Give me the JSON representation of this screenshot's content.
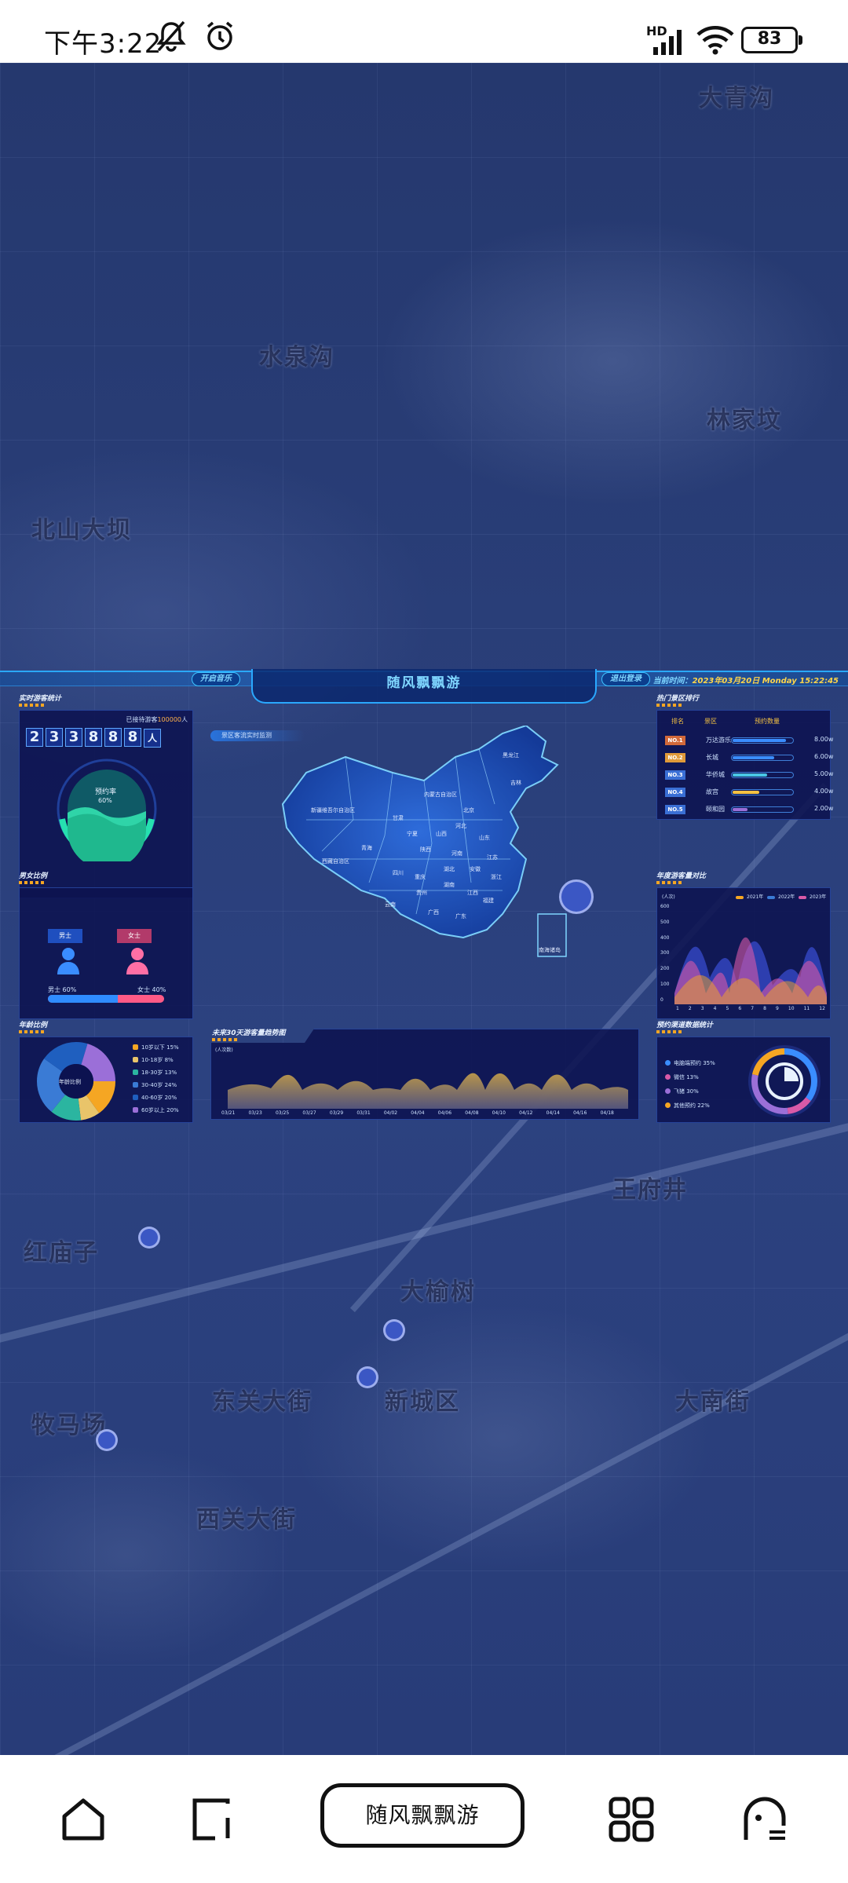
{
  "status_bar": {
    "time": "下午3:22",
    "battery": "83",
    "network": "HD"
  },
  "dashboard": {
    "title": "随风飘飘游",
    "left_button": "开启音乐",
    "right_button": "退出登录",
    "datetime_label": "当前时间：",
    "datetime_value": "2023年03月20日 Monday 15:22:45",
    "realtime": {
      "title": "实时游客统计",
      "total_label": "已接待游客",
      "total_value": "100000",
      "unit": "人",
      "digits": [
        "2",
        "3",
        "3",
        "8",
        "8",
        "8"
      ],
      "gauge_label": "预约率",
      "gauge_value": "60%"
    },
    "gender": {
      "title": "男女比例",
      "male": "男士",
      "female": "女士",
      "male_pct": "男士 60%",
      "female_pct": "女士 40%"
    },
    "age": {
      "title": "年龄比例",
      "center": "年龄比例",
      "legend": [
        "10岁以下 15%",
        "10-18岁 8%",
        "18-30岁 13%",
        "30-40岁 24%",
        "40-60岁 20%",
        "60岁以上 20%"
      ],
      "colors": [
        "#f5a623",
        "#e9c46a",
        "#2bb5a0",
        "#3a7bd5",
        "#1f5fbf",
        "#9b6fd8"
      ]
    },
    "map": {
      "subtitle": "景区客流实时监测",
      "province_labels": [
        "新疆维吾尔自治区",
        "西藏自治区",
        "青海",
        "甘肃",
        "四川",
        "云南",
        "内蒙古自治区",
        "黑龙江",
        "吉林",
        "北京",
        "河北",
        "山西",
        "陕西",
        "河南",
        "山东",
        "湖北",
        "湖南",
        "广东",
        "广西",
        "贵州",
        "重庆",
        "江西",
        "福建",
        "浙江",
        "江苏",
        "安徽",
        "宁夏",
        "南海诸岛"
      ]
    },
    "forecast": {
      "title": "未来30天游客量趋势图",
      "unit": "(人次数)",
      "x_labels": [
        "03/21",
        "03/23",
        "03/25",
        "03/27",
        "03/29",
        "03/31",
        "04/02",
        "04/04",
        "04/06",
        "04/08",
        "04/10",
        "04/12",
        "04/14",
        "04/16",
        "04/18"
      ]
    },
    "ranking": {
      "title": "热门景区排行",
      "headers": [
        "排名",
        "景区",
        "预约数量"
      ],
      "rows": [
        {
          "rank": "NO.1",
          "name": "万达游乐",
          "value": "8.00w",
          "pct": 0.9,
          "color": "#3a8dff",
          "badge": "#d2693a"
        },
        {
          "rank": "NO.2",
          "name": "长城",
          "value": "6.00w",
          "pct": 0.7,
          "color": "#3a8dff",
          "badge": "#e09a3a"
        },
        {
          "rank": "NO.3",
          "name": "华侨城",
          "value": "5.00w",
          "pct": 0.58,
          "color": "#49c6e5",
          "badge": "#3a6fd5"
        },
        {
          "rank": "NO.4",
          "name": "故宫",
          "value": "4.00w",
          "pct": 0.45,
          "color": "#f5c242",
          "badge": "#3a6fd5"
        },
        {
          "rank": "NO.5",
          "name": "颐和园",
          "value": "2.00w",
          "pct": 0.25,
          "color": "#9b6fd8",
          "badge": "#3a6fd5"
        }
      ]
    },
    "yearly": {
      "title": "年度游客量对比",
      "unit": "(人次)",
      "legend": [
        "2021年",
        "2022年",
        "2023年"
      ],
      "legend_colors": [
        "#f5a623",
        "#3a7bd5",
        "#d95aa8"
      ],
      "y_ticks": [
        "600",
        "500",
        "400",
        "300",
        "200",
        "100",
        "0"
      ],
      "x_ticks": [
        "1",
        "2",
        "3",
        "4",
        "5",
        "6",
        "7",
        "8",
        "9",
        "10",
        "11",
        "12"
      ]
    },
    "channel": {
      "title": "预约渠道数据统计",
      "legend": [
        "电脑端预约 35%",
        "微信 13%",
        "飞猪 30%",
        "其他预约 22%"
      ],
      "colors": [
        "#3a8dff",
        "#d95aa8",
        "#9b6fd8",
        "#f5a623"
      ]
    }
  },
  "nav": {
    "center_label": "随风飘飘游"
  },
  "map_labels": [
    "大青沟",
    "水泉沟",
    "北山大坝",
    "林家坟",
    "大榆树",
    "西关大街",
    "东关大街",
    "新城区",
    "红庙子",
    "大南街",
    "王府井",
    "牧马场"
  ]
}
